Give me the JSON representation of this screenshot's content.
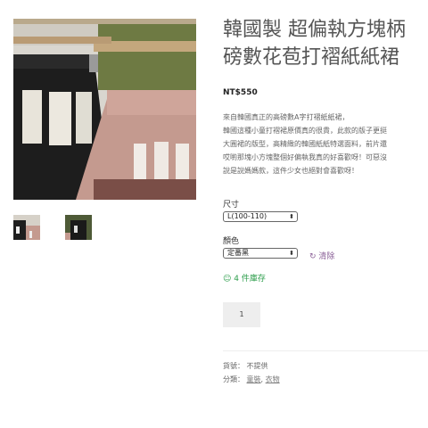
{
  "product": {
    "title_line1": "韓國製 超偏執方塊柄",
    "title_line2": "磅數花苞打褶紙紙裙",
    "price": "NT$550",
    "description": [
      "來自韓國真正的高磅數A字打褶紙紙裙，",
      "韓國這種小童打褶裙原價真的很貴，此款的版子更挺",
      "大圓裙的版型，高精緻的韓國紙紙特選面料，前片還",
      "哎喲那塊小方塊整個好偏執我真的好喜歡呀！可惡沒",
      "說是說媽媽款，這件少女也絕對會喜歡呀！"
    ],
    "size_label": "尺寸",
    "size_value": "L(100-110)",
    "color_label": "顏色",
    "color_value": "定番黑",
    "clear_label": "清除",
    "stock_text": "4 件庫存",
    "quantity": "1",
    "sku_label": "貨號：",
    "sku_value": "不提供",
    "category_label": "分類：",
    "category_1": "童裝",
    "category_sep": ",",
    "category_2": "衣物"
  },
  "icons": {
    "select_arrow": "updown-arrow-icon",
    "clear": "refresh-icon",
    "stock": "smile-icon"
  },
  "colors": {
    "accent_purple": "#8a5f97",
    "stock_green": "#2c9d4b"
  }
}
